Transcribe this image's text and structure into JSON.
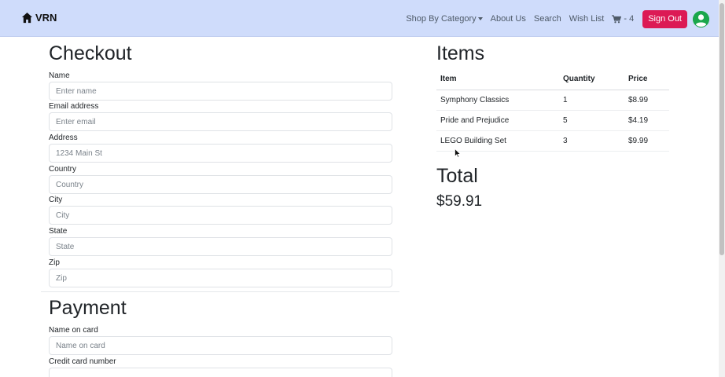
{
  "navbar": {
    "brand": "VRN",
    "links": {
      "shop_by_category": "Shop By Category",
      "about_us": "About Us",
      "search": "Search",
      "wish_list": "Wish List"
    },
    "cart_count": "- 4",
    "sign_out": "Sign Out",
    "icons": {
      "brand": "home-icon",
      "cart": "cart-icon",
      "user": "user-circle-icon"
    },
    "colors": {
      "background": "#cfdcfb",
      "sign_out": "#dc1a55",
      "avatar": "#1aa74c"
    }
  },
  "checkout": {
    "title": "Checkout",
    "fields": {
      "name": {
        "label": "Name",
        "placeholder": "Enter name"
      },
      "email": {
        "label": "Email address",
        "placeholder": "Enter email"
      },
      "address": {
        "label": "Address",
        "placeholder": "1234 Main St"
      },
      "country": {
        "label": "Country",
        "placeholder": "Country"
      },
      "city": {
        "label": "City",
        "placeholder": "City"
      },
      "state": {
        "label": "State",
        "placeholder": "State"
      },
      "zip": {
        "label": "Zip",
        "placeholder": "Zip"
      }
    }
  },
  "payment": {
    "title": "Payment",
    "fields": {
      "name_on_card": {
        "label": "Name on card",
        "placeholder": "Name on card"
      },
      "card_number": {
        "label": "Credit card number",
        "placeholder": ""
      }
    }
  },
  "items": {
    "title": "Items",
    "headers": {
      "item": "Item",
      "quantity": "Quantity",
      "price": "Price"
    },
    "rows": [
      {
        "item": "Symphony Classics",
        "quantity": "1",
        "price": "$8.99"
      },
      {
        "item": "Pride and Prejudice",
        "quantity": "5",
        "price": "$4.19"
      },
      {
        "item": "LEGO Building Set",
        "quantity": "3",
        "price": "$9.99"
      }
    ]
  },
  "total": {
    "title": "Total",
    "value": "$59.91"
  }
}
